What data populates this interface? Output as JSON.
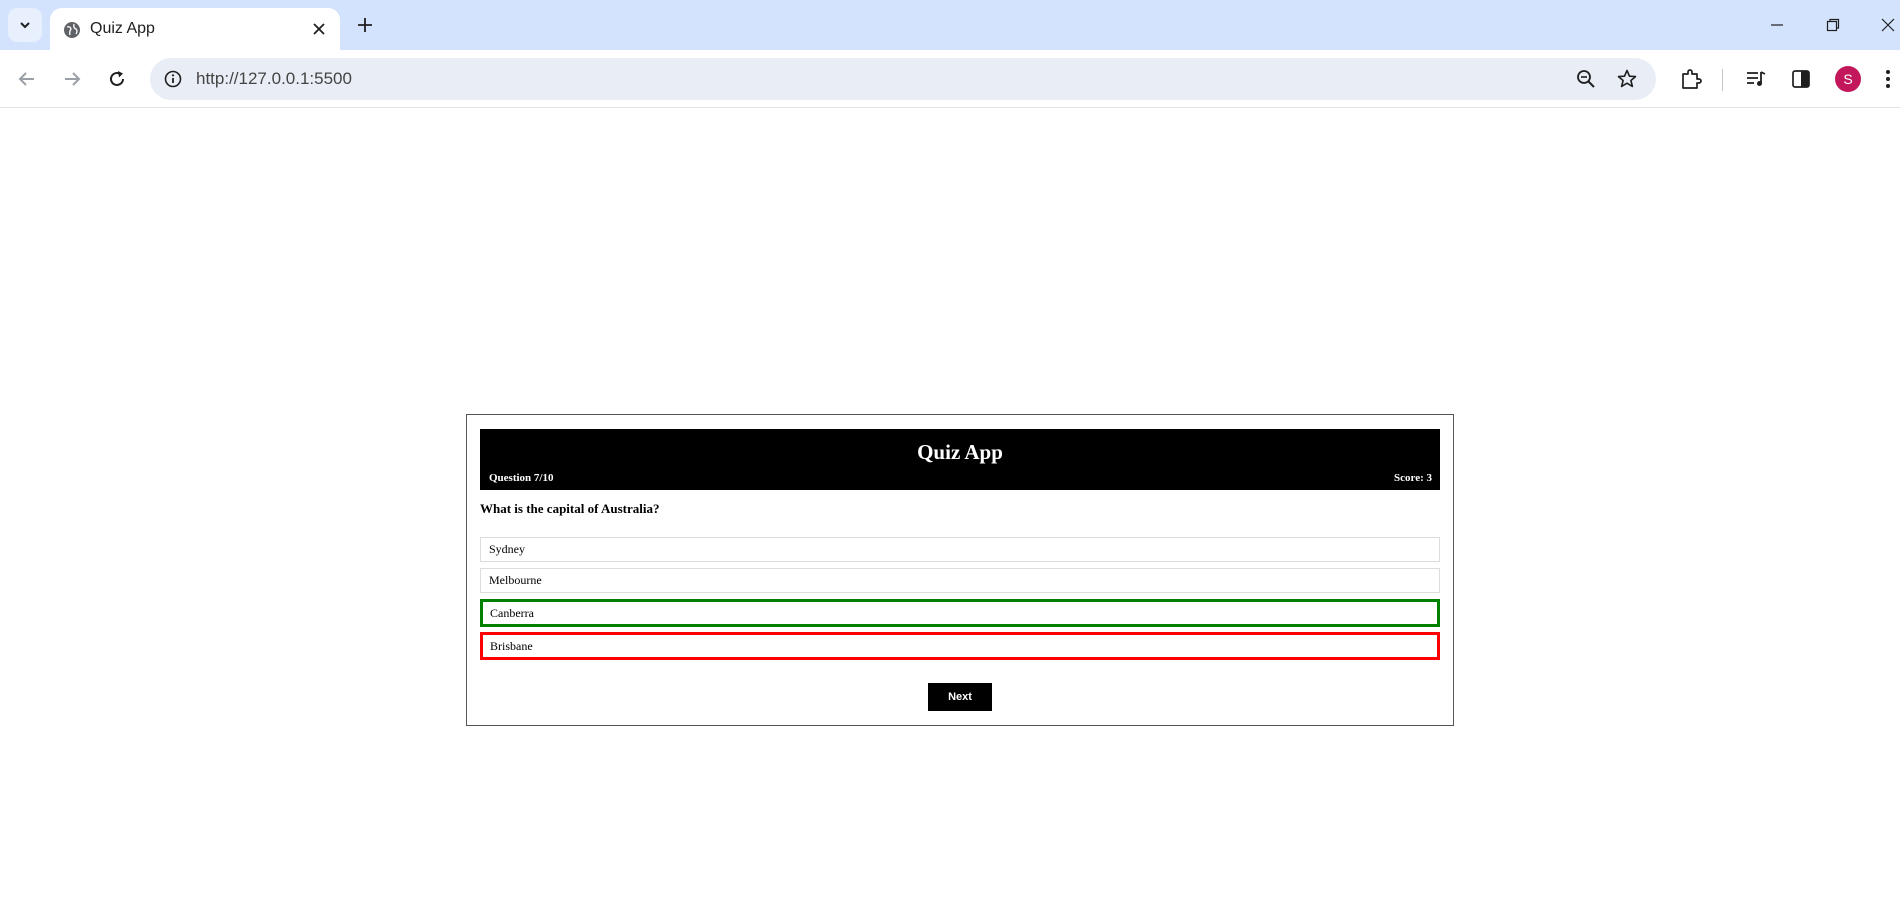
{
  "browser": {
    "tab_title": "Quiz App",
    "url": "http://127.0.0.1:5500",
    "profile_initial": "S",
    "icons": {
      "tab_search": "chevron-down-icon",
      "favicon": "globe-icon",
      "tab_close": "close-icon",
      "new_tab": "plus-icon",
      "back": "back-arrow-icon",
      "forward": "forward-arrow-icon",
      "reload": "reload-icon",
      "site_info": "info-icon",
      "zoom": "zoom-out-icon",
      "bookmark": "star-icon",
      "extensions": "puzzle-icon",
      "media": "media-controls-icon",
      "side_panel": "side-panel-icon",
      "menu": "kebab-menu-icon"
    }
  },
  "quiz": {
    "title": "Quiz App",
    "counter": "Question 7/10",
    "score": "Score: 3",
    "question": "What is the capital of Australia?",
    "options": [
      {
        "label": "Sydney",
        "state": "neutral"
      },
      {
        "label": "Melbourne",
        "state": "neutral"
      },
      {
        "label": "Canberra",
        "state": "correct"
      },
      {
        "label": "Brisbane",
        "state": "wrong"
      }
    ],
    "next_label": "Next"
  },
  "colors": {
    "tabstrip": "#d3e3fd",
    "header_bg": "#000000",
    "correct_border": "#008000",
    "wrong_border": "#ff0000",
    "avatar": "#c2185b"
  }
}
